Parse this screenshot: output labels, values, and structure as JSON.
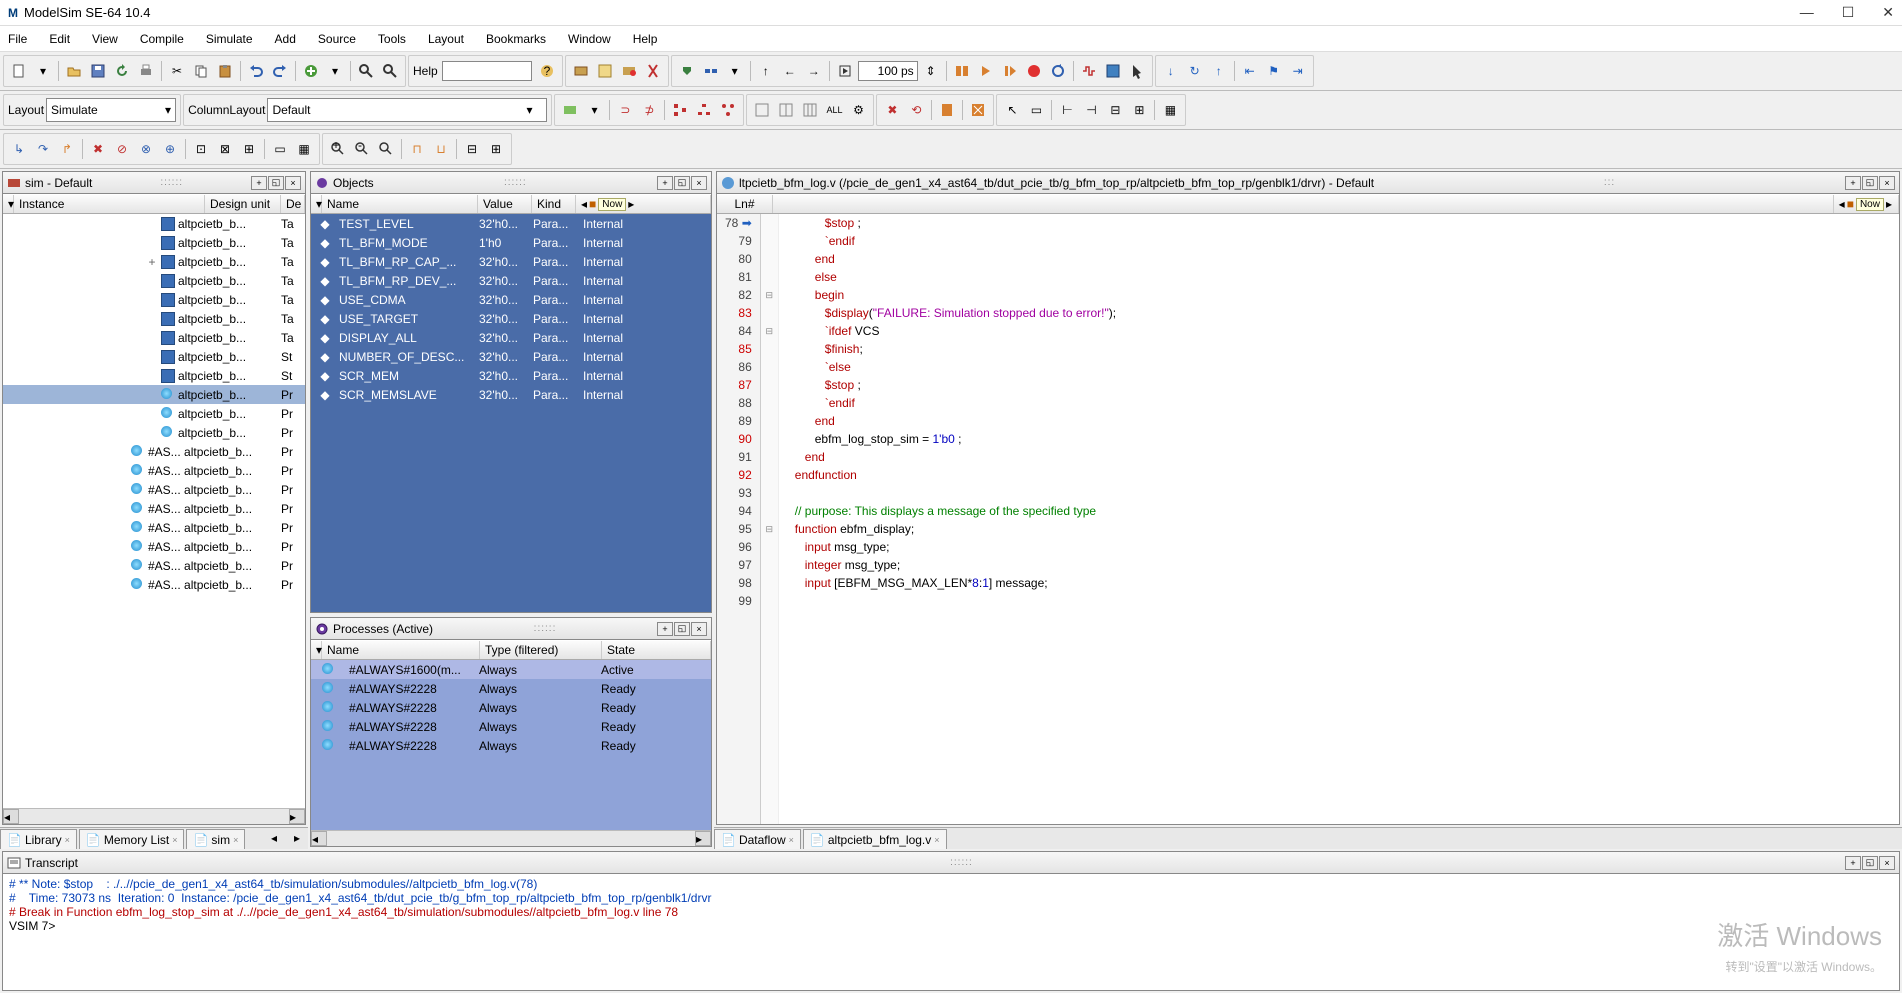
{
  "app": {
    "title": "ModelSim SE-64 10.4"
  },
  "menu": [
    "File",
    "Edit",
    "View",
    "Compile",
    "Simulate",
    "Add",
    "Source",
    "Tools",
    "Layout",
    "Bookmarks",
    "Window",
    "Help"
  ],
  "layout": {
    "label": "Layout",
    "value": "Simulate"
  },
  "columnlayout": {
    "label": "ColumnLayout",
    "value": "Default"
  },
  "help_label": "Help",
  "ps": {
    "value": "100 ps"
  },
  "sim_pane": {
    "title": "sim - Default",
    "cols": [
      "Instance",
      "Design unit",
      "De"
    ],
    "rows": [
      {
        "name": "altpcietb_b...",
        "du": "Ta",
        "type": "mod",
        "sel": false
      },
      {
        "name": "altpcietb_b...",
        "du": "Ta",
        "type": "mod",
        "sel": false
      },
      {
        "name": "altpcietb_b...",
        "du": "Ta",
        "type": "mod",
        "sel": false,
        "expander": "+"
      },
      {
        "name": "altpcietb_b...",
        "du": "Ta",
        "type": "mod",
        "sel": false
      },
      {
        "name": "altpcietb_b...",
        "du": "Ta",
        "type": "mod",
        "sel": false
      },
      {
        "name": "altpcietb_b...",
        "du": "Ta",
        "type": "mod",
        "sel": false
      },
      {
        "name": "altpcietb_b...",
        "du": "Ta",
        "type": "mod",
        "sel": false
      },
      {
        "name": "altpcietb_b...",
        "du": "St",
        "type": "mod",
        "sel": false
      },
      {
        "name": "altpcietb_b...",
        "du": "St",
        "type": "mod",
        "sel": false
      },
      {
        "name": "altpcietb_b...",
        "du": "Pr",
        "type": "ball",
        "sel": true
      },
      {
        "name": "altpcietb_b...",
        "du": "Pr",
        "type": "ball",
        "sel": false
      },
      {
        "name": "altpcietb_b...",
        "du": "Pr",
        "type": "ball",
        "sel": false
      },
      {
        "name": "#AS... altpcietb_b...",
        "du": "Pr",
        "type": "ball",
        "sel": false,
        "prefix": "#AS..."
      },
      {
        "name": "#AS... altpcietb_b...",
        "du": "Pr",
        "type": "ball",
        "sel": false,
        "prefix": "#AS..."
      },
      {
        "name": "#AS... altpcietb_b...",
        "du": "Pr",
        "type": "ball",
        "sel": false,
        "prefix": "#AS..."
      },
      {
        "name": "#AS... altpcietb_b...",
        "du": "Pr",
        "type": "ball",
        "sel": false,
        "prefix": "#AS..."
      },
      {
        "name": "#AS... altpcietb_b...",
        "du": "Pr",
        "type": "ball",
        "sel": false,
        "prefix": "#AS..."
      },
      {
        "name": "#AS... altpcietb_b...",
        "du": "Pr",
        "type": "ball",
        "sel": false,
        "prefix": "#AS..."
      },
      {
        "name": "#AS... altpcietb_b...",
        "du": "Pr",
        "type": "ball",
        "sel": false,
        "prefix": "#AS..."
      },
      {
        "name": "#AS... altpcietb_b...",
        "du": "Pr",
        "type": "ball",
        "sel": false,
        "prefix": "#AS..."
      }
    ]
  },
  "bottom_tabs_left": [
    {
      "label": "Library",
      "icon": "lib"
    },
    {
      "label": "Memory List",
      "icon": "mem"
    },
    {
      "label": "sim",
      "icon": "sim"
    }
  ],
  "objects_pane": {
    "title": "Objects",
    "cols": [
      "Name",
      "Value",
      "Kind",
      ""
    ],
    "now_label": "Now",
    "rows": [
      {
        "name": "TEST_LEVEL",
        "value": "32'h0...",
        "kind": "Para...",
        "int": "Internal"
      },
      {
        "name": "TL_BFM_MODE",
        "value": "1'h0",
        "kind": "Para...",
        "int": "Internal"
      },
      {
        "name": "TL_BFM_RP_CAP_...",
        "value": "32'h0...",
        "kind": "Para...",
        "int": "Internal"
      },
      {
        "name": "TL_BFM_RP_DEV_...",
        "value": "32'h0...",
        "kind": "Para...",
        "int": "Internal"
      },
      {
        "name": "USE_CDMA",
        "value": "32'h0...",
        "kind": "Para...",
        "int": "Internal"
      },
      {
        "name": "USE_TARGET",
        "value": "32'h0...",
        "kind": "Para...",
        "int": "Internal"
      },
      {
        "name": "DISPLAY_ALL",
        "value": "32'h0...",
        "kind": "Para...",
        "int": "Internal"
      },
      {
        "name": "NUMBER_OF_DESC...",
        "value": "32'h0...",
        "kind": "Para...",
        "int": "Internal"
      },
      {
        "name": "SCR_MEM",
        "value": "32'h0...",
        "kind": "Para...",
        "int": "Internal"
      },
      {
        "name": "SCR_MEMSLAVE",
        "value": "32'h0...",
        "kind": "Para...",
        "int": "Internal"
      }
    ]
  },
  "processes_pane": {
    "title": "Processes (Active)",
    "cols": [
      "Name",
      "Type (filtered)",
      "State"
    ],
    "rows": [
      {
        "name": "#ALWAYS#1600(m...",
        "type": "Always",
        "state": "Active",
        "active": true
      },
      {
        "name": "#ALWAYS#2228",
        "type": "Always",
        "state": "Ready"
      },
      {
        "name": "#ALWAYS#2228",
        "type": "Always",
        "state": "Ready"
      },
      {
        "name": "#ALWAYS#2228",
        "type": "Always",
        "state": "Ready"
      },
      {
        "name": "#ALWAYS#2228",
        "type": "Always",
        "state": "Ready"
      }
    ]
  },
  "source_pane": {
    "title": "ltpcietb_bfm_log.v (/pcie_de_gen1_x4_ast64_tb/dut_pcie_tb/g_bfm_top_rp/altpcietb_bfm_top_rp/genblk1/drvr) - Default",
    "ln_label": "Ln#",
    "now_label": "Now",
    "lines": [
      {
        "n": 78,
        "red": false,
        "arrow": true,
        "html": "            <span class='kw'>$stop</span> ;"
      },
      {
        "n": 79,
        "red": false,
        "html": "            <span class='kw'>`endif</span>"
      },
      {
        "n": 80,
        "red": false,
        "html": "         <span class='kw'>end</span>"
      },
      {
        "n": 81,
        "red": false,
        "html": "         <span class='kw'>else</span>"
      },
      {
        "n": 82,
        "red": false,
        "html": "         <span class='kw'>begin</span>",
        "fold": "⊟"
      },
      {
        "n": 83,
        "red": true,
        "html": "            <span class='kw'>$display</span>(<span class='str'>\"FAILURE: Simulation stopped due to error!\"</span>);"
      },
      {
        "n": 84,
        "red": false,
        "html": "            <span class='kw'>`ifdef</span> VCS",
        "fold": "⊟"
      },
      {
        "n": 85,
        "red": true,
        "html": "            <span class='kw'>$finish</span>;"
      },
      {
        "n": 86,
        "red": false,
        "html": "            <span class='kw'>`else</span>"
      },
      {
        "n": 87,
        "red": true,
        "html": "            <span class='kw'>$stop</span> ;"
      },
      {
        "n": 88,
        "red": false,
        "html": "            <span class='kw'>`endif</span>"
      },
      {
        "n": 89,
        "red": false,
        "html": "         <span class='kw'>end</span>"
      },
      {
        "n": 90,
        "red": true,
        "html": "         ebfm_log_stop_sim = <span class='num'>1'b0</span> ;"
      },
      {
        "n": 91,
        "red": false,
        "html": "      <span class='kw'>end</span>"
      },
      {
        "n": 92,
        "red": true,
        "html": "   <span class='kw'>endfunction</span>"
      },
      {
        "n": 93,
        "red": false,
        "html": ""
      },
      {
        "n": 94,
        "red": false,
        "html": "   <span class='cm'>// purpose: This displays a message of the specified type</span>"
      },
      {
        "n": 95,
        "red": false,
        "html": "   <span class='kw'>function</span> ebfm_display;",
        "fold": "⊟"
      },
      {
        "n": 96,
        "red": false,
        "html": "      <span class='kw'>input</span> msg_type;"
      },
      {
        "n": 97,
        "red": false,
        "html": "      <span class='kw'>integer</span> msg_type;"
      },
      {
        "n": 98,
        "red": false,
        "html": "      <span class='kw'>input</span> [EBFM_MSG_MAX_LEN*<span class='num'>8</span>:<span class='num'>1</span>] message;"
      },
      {
        "n": 99,
        "red": false,
        "html": ""
      }
    ]
  },
  "bottom_tabs_right": [
    {
      "label": "Dataflow",
      "icon": "flow"
    },
    {
      "label": "altpcietb_bfm_log.v",
      "icon": "v"
    }
  ],
  "transcript": {
    "title": "Transcript",
    "lines": [
      "# ** Note: $stop    : ./..//pcie_de_gen1_x4_ast64_tb/simulation/submodules//altpcietb_bfm_log.v(78)",
      "#    Time: 73073 ns  Iteration: 0  Instance: /pcie_de_gen1_x4_ast64_tb/dut_pcie_tb/g_bfm_top_rp/altpcietb_bfm_top_rp/genblk1/drvr",
      "# Break in Function ebfm_log_stop_sim at ./..//pcie_de_gen1_x4_ast64_tb/simulation/submodules//altpcietb_bfm_log.v line 78"
    ],
    "prompt": "VSIM 7>"
  },
  "watermark1": "激活 Windows",
  "watermark2": "转到\"设置\"以激活 Windows。"
}
